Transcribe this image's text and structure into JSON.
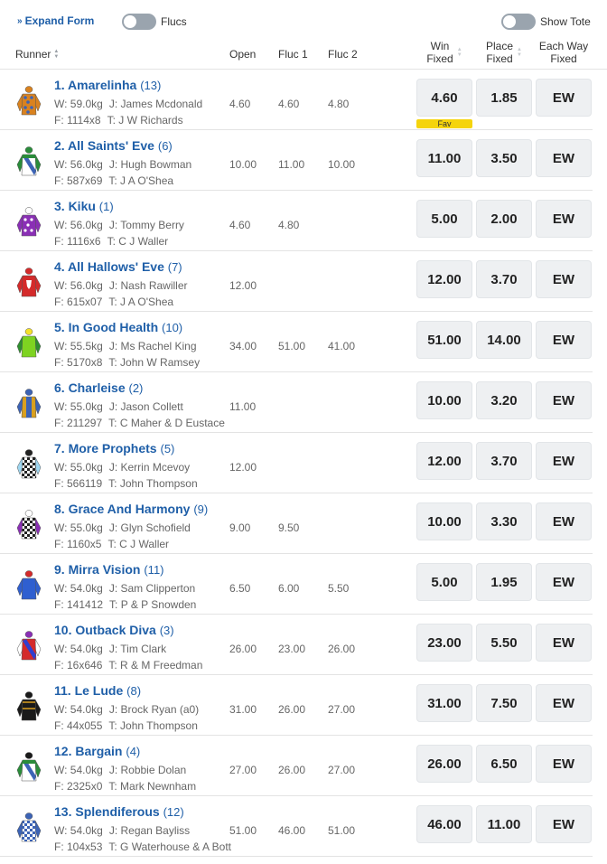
{
  "controls": {
    "expand_label": "Expand Form",
    "flucs_label": "Flucs",
    "tote_label": "Show Tote"
  },
  "columns": {
    "runner": "Runner",
    "open": "Open",
    "fluc1": "Fluc 1",
    "fluc2": "Fluc 2",
    "win_1": "Win",
    "win_2": "Fixed",
    "place_1": "Place",
    "place_2": "Fixed",
    "ew_1": "Each Way",
    "ew_2": "Fixed"
  },
  "runners": [
    {
      "name": "1. Amarelinha",
      "barrier": "(13)",
      "weight": "W: 59.0kg",
      "jockey": "J: James Mcdonald",
      "form": "F: 1114x8",
      "trainer": "T: J W Richards",
      "open": "4.60",
      "fluc1": "4.60",
      "fluc2": "4.80",
      "win": "4.60",
      "place": "1.85",
      "ew": "EW",
      "badge": "Fav",
      "silk": {
        "body": "#d9821f",
        "pattern": "dots-blue",
        "sleeve": "#d9821f",
        "cap": "#d9821f"
      }
    },
    {
      "name": "2. All Saints' Eve",
      "barrier": "(6)",
      "weight": "W: 56.0kg",
      "jockey": "J: Hugh Bowman",
      "form": "F: 587x69",
      "trainer": "T: J A O'Shea",
      "open": "10.00",
      "fluc1": "11.00",
      "fluc2": "10.00",
      "win": "11.00",
      "place": "3.50",
      "ew": "EW",
      "silk": {
        "body": "#ffffff",
        "pattern": "sash-green",
        "sleeve": "#2a8c3a",
        "cap": "#2a8c3a"
      }
    },
    {
      "name": "3. Kiku",
      "barrier": "(1)",
      "weight": "W: 56.0kg",
      "jockey": "J: Tommy Berry",
      "form": "F: 1116x6",
      "trainer": "T: C J Waller",
      "open": "4.60",
      "fluc1": "4.80",
      "fluc2": "",
      "win": "5.00",
      "place": "2.00",
      "ew": "EW",
      "silk": {
        "body": "#8a2fb5",
        "pattern": "stars-white",
        "sleeve": "#8a2fb5",
        "cap": "#ffffff"
      }
    },
    {
      "name": "4. All Hallows' Eve",
      "barrier": "(7)",
      "weight": "W: 56.0kg",
      "jockey": "J: Nash Rawiller",
      "form": "F: 615x07",
      "trainer": "T: J A O'Shea",
      "open": "12.00",
      "fluc1": "",
      "fluc2": "",
      "win": "12.00",
      "place": "3.70",
      "ew": "EW",
      "silk": {
        "body": "#d42a2a",
        "pattern": "emblem-white",
        "sleeve": "#d42a2a",
        "cap": "#d42a2a"
      }
    },
    {
      "name": "5. In Good Health",
      "barrier": "(10)",
      "weight": "W: 55.5kg",
      "jockey": "J: Ms Rachel King",
      "form": "F: 5170x8",
      "trainer": "T: John W Ramsey",
      "open": "34.00",
      "fluc1": "51.00",
      "fluc2": "41.00",
      "win": "51.00",
      "place": "14.00",
      "ew": "EW",
      "silk": {
        "body": "#7ed321",
        "pattern": "none",
        "sleeve": "#2f8f2f",
        "cap": "#f5e02a"
      }
    },
    {
      "name": "6. Charleise",
      "barrier": "(2)",
      "weight": "W: 55.0kg",
      "jockey": "J: Jason Collett",
      "form": "F: 211297",
      "trainer": "T: C Maher & D Eustace",
      "open": "11.00",
      "fluc1": "",
      "fluc2": "",
      "win": "10.00",
      "place": "3.20",
      "ew": "EW",
      "silk": {
        "body": "#d9a020",
        "pattern": "panel-blue",
        "sleeve": "#3c63b5",
        "cap": "#3c63b5"
      }
    },
    {
      "name": "7. More Prophets",
      "barrier": "(5)",
      "weight": "W: 55.0kg",
      "jockey": "J: Kerrin Mcevoy",
      "form": "F: 566119",
      "trainer": "T: John Thompson",
      "open": "12.00",
      "fluc1": "",
      "fluc2": "",
      "win": "12.00",
      "place": "3.70",
      "ew": "EW",
      "silk": {
        "body": "#ffffff",
        "pattern": "checks-black",
        "sleeve": "#9ed6f0",
        "cap": "#222222"
      }
    },
    {
      "name": "8. Grace And Harmony",
      "barrier": "(9)",
      "weight": "W: 55.0kg",
      "jockey": "J: Glyn Schofield",
      "form": "F: 1160x5",
      "trainer": "T: C J Waller",
      "open": "9.00",
      "fluc1": "9.50",
      "fluc2": "",
      "win": "10.00",
      "place": "3.30",
      "ew": "EW",
      "silk": {
        "body": "#ffffff",
        "pattern": "checks-black",
        "sleeve": "#8a2fb5",
        "cap": "#ffffff"
      }
    },
    {
      "name": "9. Mirra Vision",
      "barrier": "(11)",
      "weight": "W: 54.0kg",
      "jockey": "J: Sam Clipperton",
      "form": "F: 141412",
      "trainer": "T: P & P Snowden",
      "open": "6.50",
      "fluc1": "6.00",
      "fluc2": "5.50",
      "win": "5.00",
      "place": "1.95",
      "ew": "EW",
      "silk": {
        "body": "#2f5fd0",
        "pattern": "none",
        "sleeve": "#2f5fd0",
        "cap": "#d42a2a"
      }
    },
    {
      "name": "10. Outback Diva",
      "barrier": "(3)",
      "weight": "W: 54.0kg",
      "jockey": "J: Tim Clark",
      "form": "F: 16x646",
      "trainer": "T: R & M Freedman",
      "open": "26.00",
      "fluc1": "23.00",
      "fluc2": "26.00",
      "win": "23.00",
      "place": "5.50",
      "ew": "EW",
      "silk": {
        "body": "#d42a2a",
        "pattern": "sash-purple",
        "sleeve": "#ffffff",
        "cap": "#8a2fb5"
      }
    },
    {
      "name": "11. Le Lude",
      "barrier": "(8)",
      "weight": "W: 54.0kg",
      "jockey": "J: Brock Ryan (a0)",
      "form": "F: 44x055",
      "trainer": "T: John Thompson",
      "open": "31.00",
      "fluc1": "26.00",
      "fluc2": "27.00",
      "win": "31.00",
      "place": "7.50",
      "ew": "EW",
      "silk": {
        "body": "#1a1a1a",
        "pattern": "braid-gold",
        "sleeve": "#1a1a1a",
        "cap": "#1a1a1a"
      }
    },
    {
      "name": "12. Bargain",
      "barrier": "(4)",
      "weight": "W: 54.0kg",
      "jockey": "J: Robbie Dolan",
      "form": "F: 2325x0",
      "trainer": "T: Mark Newnham",
      "open": "27.00",
      "fluc1": "26.00",
      "fluc2": "27.00",
      "win": "26.00",
      "place": "6.50",
      "ew": "EW",
      "silk": {
        "body": "#ffffff",
        "pattern": "sash-green",
        "sleeve": "#2a8c3a",
        "cap": "#1a1a1a"
      }
    },
    {
      "name": "13. Splendiferous",
      "barrier": "(12)",
      "weight": "W: 54.0kg",
      "jockey": "J: Regan Bayliss",
      "form": "F: 104x53",
      "trainer": "T: G Waterhouse & A Bott",
      "open": "51.00",
      "fluc1": "46.00",
      "fluc2": "51.00",
      "win": "46.00",
      "place": "11.00",
      "ew": "EW",
      "silk": {
        "body": "#ffffff",
        "pattern": "checks-blue",
        "sleeve": "#3c63b5",
        "cap": "#3c63b5"
      }
    }
  ]
}
